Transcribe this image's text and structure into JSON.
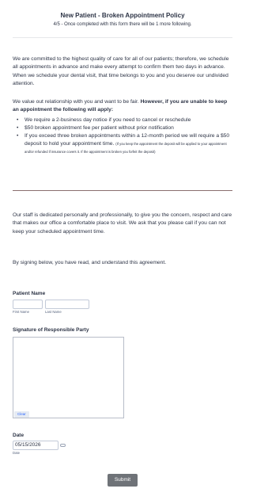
{
  "header": {
    "title": "New Patient - Broken Appointment Policy",
    "subtitle": "4/5 - Once completed with this form there will be 1 more following."
  },
  "policy": {
    "intro": "We are committed to the highest quality of care for all of our patients; therefore, we schedule all appointments in advance and make every attempt to confirm them two days in advance. When we schedule your dental visit, that time belongs to you and you deserve our undivided attention.",
    "relationship_lead": "We value out relationship with you and want to be fair. ",
    "relationship_bold": "However, if you are unable to keep an appointment the following will apply:",
    "bullets": [
      "We require a 2-business day notice if you need to cancel or reschedule",
      "$50 broken appointment fee per patient without prior notification",
      "If you exceed three broken appointments within a 12-month period we will require a $50 deposit to hold your appointment time."
    ],
    "deposit_note": "(If you keep the appointment the deposit will be applied to your appointment and/or refunded if insurance covers it. If the appointment is broken you forfeit the deposit)",
    "staff": "Our staff is dedicated personally and professionally, to give you the concern, respect and care that makes our office a comfortable place to visit. We ask that you please call if you can not keep your scheduled appointment time.",
    "agreement": "By signing below, you have read, and understand this agreement."
  },
  "form": {
    "patient_name_label": "Patient Name",
    "first_name_value": "",
    "last_name_value": "",
    "first_name_sublabel": "First Name",
    "last_name_sublabel": "Last Name",
    "signature_label": "Signature of Responsible Party",
    "clear_label": "Clear",
    "date_label": "Date",
    "date_value": "05/15/2026",
    "date_sublabel": "Date",
    "submit_label": "Submit"
  },
  "icons": {
    "calendar": "calendar-icon"
  }
}
